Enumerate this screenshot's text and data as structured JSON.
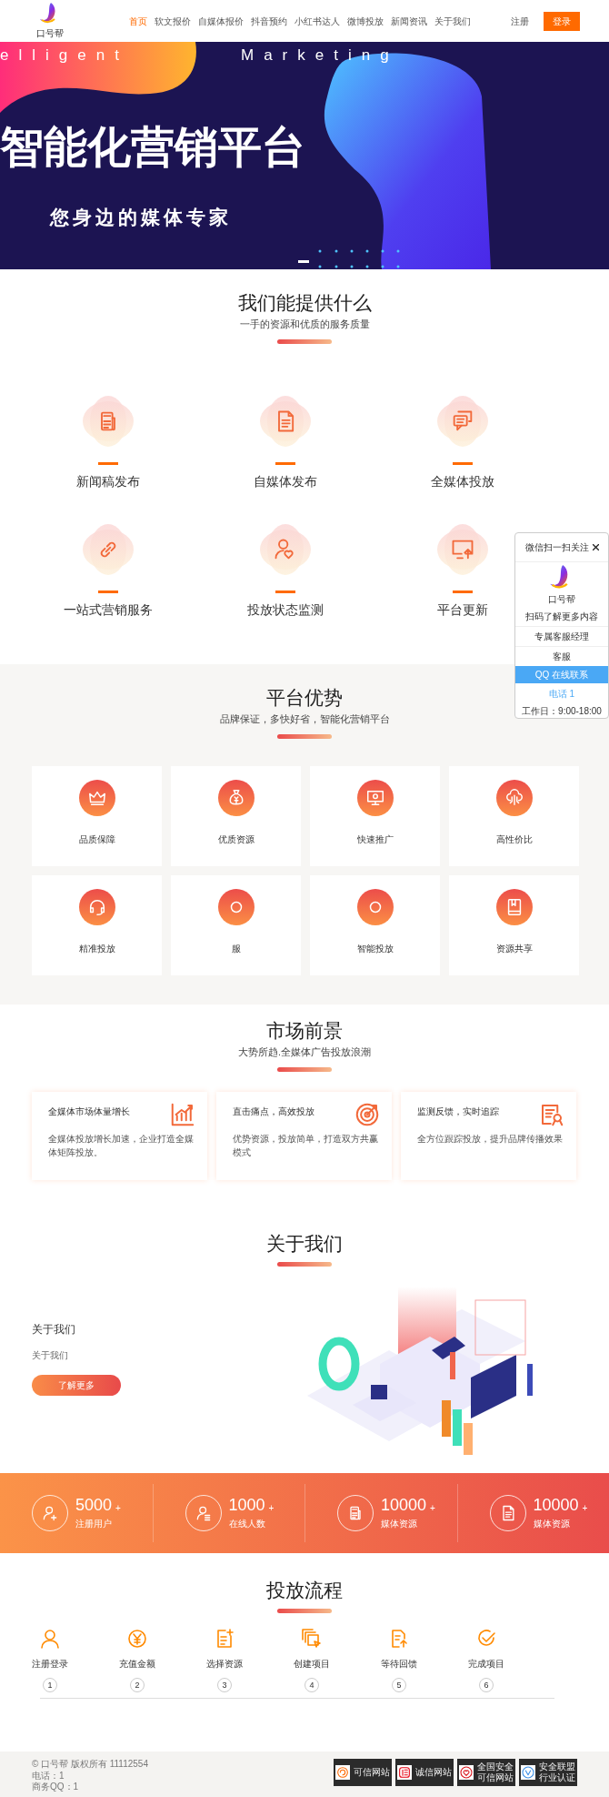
{
  "header": {
    "logo_text": "口号帮",
    "nav": [
      {
        "label": "首页",
        "selected": true
      },
      {
        "label": "软文报价",
        "selected": false
      },
      {
        "label": "自媒体报价",
        "selected": false
      },
      {
        "label": "抖音预约",
        "selected": false
      },
      {
        "label": "小红书达人",
        "selected": false
      },
      {
        "label": "微博投放",
        "selected": false
      },
      {
        "label": "新闻资讯",
        "selected": false
      },
      {
        "label": "关于我们",
        "selected": false
      }
    ],
    "register": "注册",
    "login": "登录"
  },
  "hero": {
    "words": [
      "elligent",
      "Marketing"
    ],
    "title": "智能化营销平台",
    "subtitle": "您身边的媒体专家"
  },
  "services": {
    "title": "我们能提供什么",
    "subtitle": "一手的资源和优质的服务质量",
    "items": [
      {
        "label": "新闻稿发布",
        "kind": "news"
      },
      {
        "label": "自媒体发布",
        "kind": "doc"
      },
      {
        "label": "全媒体投放",
        "kind": "chat"
      },
      {
        "label": "一站式营销服务",
        "kind": "link"
      },
      {
        "label": "投放状态监测",
        "kind": "user-heart"
      },
      {
        "label": "平台更新",
        "kind": "monitor-up"
      }
    ]
  },
  "advantages": {
    "title": "平台优势",
    "subtitle": "品牌保证，多快好省，智能化营销平台",
    "items": [
      {
        "label": "品质保障",
        "kind": "crown"
      },
      {
        "label": "优质资源",
        "kind": "money-bag"
      },
      {
        "label": "快速推广",
        "kind": "monitor-gear"
      },
      {
        "label": "高性价比",
        "kind": "cloud"
      },
      {
        "label": "精准投放",
        "kind": "headset"
      },
      {
        "label": "服",
        "kind": "circle"
      },
      {
        "label": "智能投放",
        "kind": "circle"
      },
      {
        "label": "资源共享",
        "kind": "book"
      }
    ]
  },
  "market": {
    "title": "市场前景",
    "subtitle": "大势所趋.全媒体广告投放浪潮",
    "items": [
      {
        "title": "全媒体市场体量增长",
        "text": "全媒体投放增长加速，企业打造全媒体矩阵投放。",
        "kind": "chart"
      },
      {
        "title": "直击痛点，高效投放",
        "text": "优势资源，投放简单，打造双方共赢模式",
        "kind": "target"
      },
      {
        "title": "监测反馈，实时追踪",
        "text": "全方位跟踪投放，提升品牌传播效果",
        "kind": "certificate"
      }
    ]
  },
  "about": {
    "title": "关于我们",
    "heading": "关于我们",
    "text": "关于我们",
    "button": "了解更多"
  },
  "stats": [
    {
      "value": "5000",
      "unit": "+",
      "label": "注册用户",
      "kind": "user-add"
    },
    {
      "value": "1000",
      "unit": "+",
      "label": "在线人数",
      "kind": "user-list"
    },
    {
      "value": "10000",
      "unit": "+",
      "label": "媒体资源",
      "kind": "news"
    },
    {
      "value": "10000",
      "unit": "+",
      "label": "媒体资源",
      "kind": "doc"
    }
  ],
  "flow": {
    "title": "投放流程",
    "steps": [
      {
        "label": "注册登录",
        "number": "1",
        "kind": "user"
      },
      {
        "label": "充值金额",
        "number": "2",
        "kind": "yen"
      },
      {
        "label": "选择资源",
        "number": "3",
        "kind": "doc-add"
      },
      {
        "label": "创建项目",
        "number": "4",
        "kind": "copy"
      },
      {
        "label": "等待回馈",
        "number": "5",
        "kind": "doc-up"
      },
      {
        "label": "完成项目",
        "number": "6",
        "kind": "check"
      }
    ]
  },
  "footer": {
    "lines": [
      "© 口号帮 版权所有 11112554",
      "电话：1",
      "商务QQ：1"
    ],
    "badges": [
      {
        "label": "可信网站",
        "kind": "swirl"
      },
      {
        "label": "诚信网站",
        "kind": "seal"
      },
      {
        "label": "全国安全可信网站",
        "kind": "heart"
      },
      {
        "label": "安全联盟行业认证",
        "kind": "shield"
      }
    ]
  },
  "side_panel": {
    "header": "微信扫一扫关注",
    "logo_text": "口号帮",
    "caption": "扫码了解更多内容",
    "manager": "专属客服经理",
    "service": "客服",
    "qq": "QQ 在线联系",
    "phone": "电话 1",
    "hours": "工作日：9:00-18:00"
  }
}
